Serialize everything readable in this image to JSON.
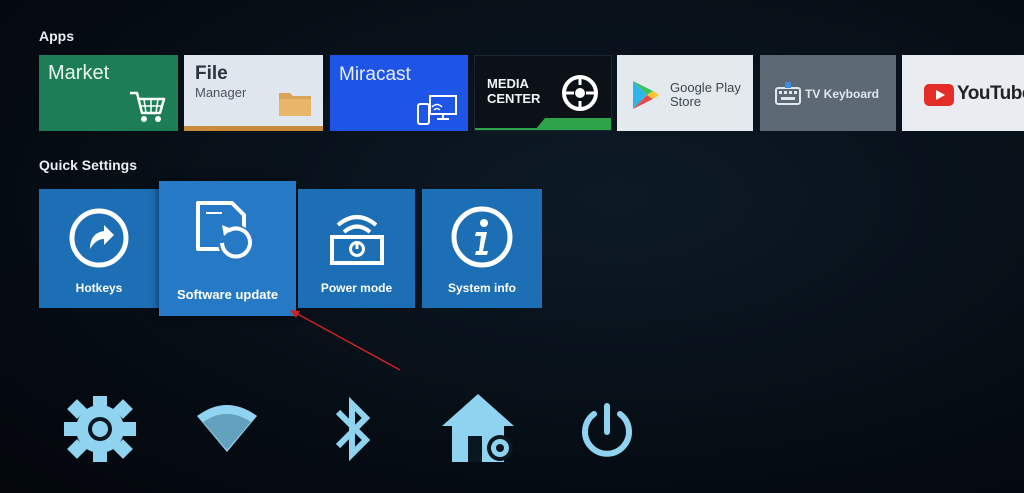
{
  "sections": {
    "apps": "Apps",
    "quick_settings": "Quick Settings"
  },
  "apps": {
    "market": {
      "label": "Market",
      "icon": "cart-icon"
    },
    "file_manager": {
      "label": "File",
      "sub": "Manager",
      "icon": "folder-icon"
    },
    "miracast": {
      "label": "Miracast",
      "icon": "cast-icon"
    },
    "media_center": {
      "label_line1": "MEDIA",
      "label_line2": "CENTER",
      "icon": "film-reel-icon"
    },
    "google_play": {
      "label_line1": "Google Play",
      "label_line2": "Store",
      "icon": "play-store-icon"
    },
    "tv_keyboard": {
      "label": "TV Keyboard",
      "icon": "keyboard-icon"
    },
    "youtube": {
      "label": "YouTube",
      "icon": "youtube-icon"
    }
  },
  "quick_settings": {
    "hotkeys": "Hotkeys",
    "software_update": "Software update",
    "power_mode": "Power mode",
    "system_info": "System info"
  },
  "dock": [
    "settings-icon",
    "wifi-icon",
    "bluetooth-icon",
    "home-settings-icon",
    "power-icon"
  ],
  "colors": {
    "market": "#1c7d57",
    "miracast": "#1f55e6",
    "quick_settings_tile": "#1c6eb5",
    "dock_icon": "#8fd3f0",
    "annotation_arrow": "#cc2222"
  }
}
